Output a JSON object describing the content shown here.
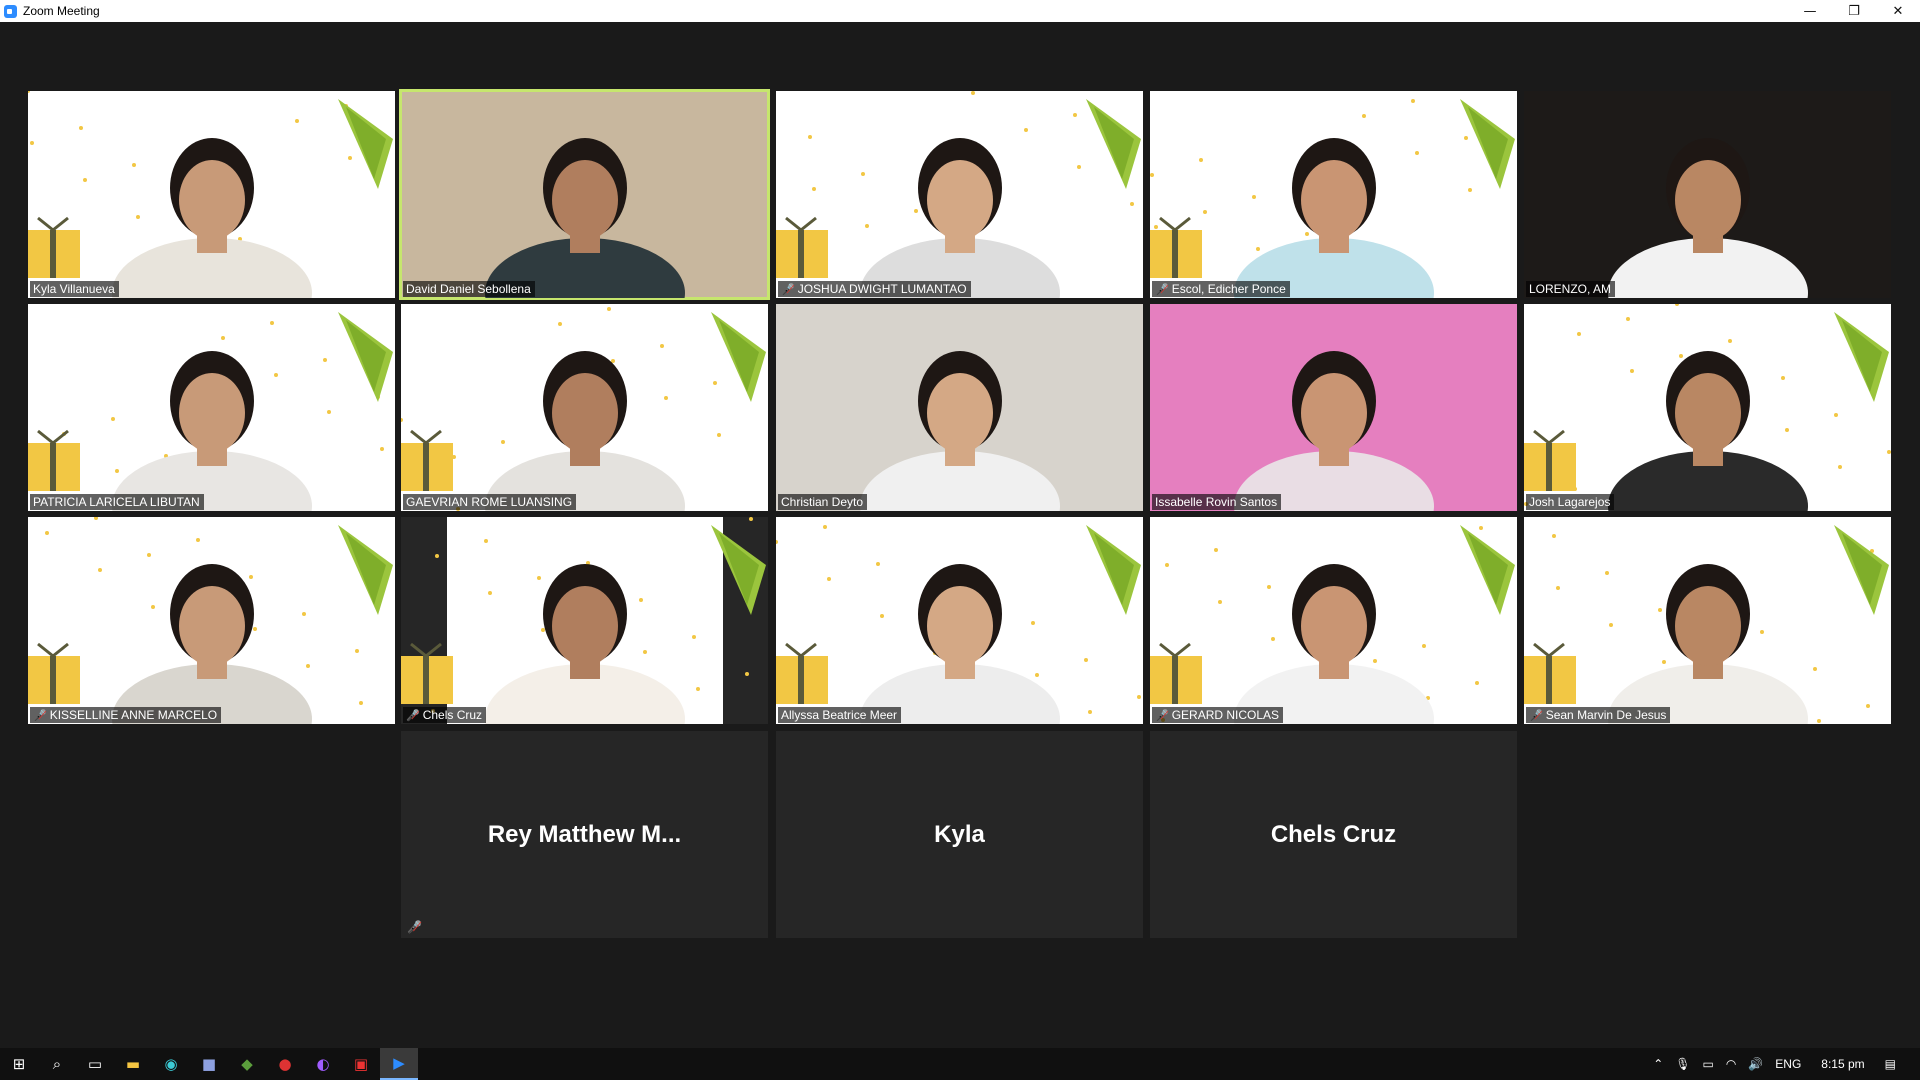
{
  "window": {
    "title": "Zoom Meeting",
    "minimize_glyph": "—",
    "restore_glyph": "❐",
    "close_glyph": "✕"
  },
  "participants": [
    {
      "name": "Kyla Villanueva",
      "muted": false,
      "video": true
    },
    {
      "name": "David Daniel Sebollena",
      "muted": false,
      "video": true,
      "active_speaker": true
    },
    {
      "name": "JOSHUA DWIGHT LUMANTAO",
      "muted": true,
      "video": true
    },
    {
      "name": "Escol, Edicher Ponce",
      "muted": true,
      "video": true
    },
    {
      "name": "LORENZO, AM",
      "muted": false,
      "video": true
    },
    {
      "name": "PATRICIA LARICELA LIBUTAN",
      "muted": false,
      "video": true
    },
    {
      "name": "GAEVRIAN ROME LUANSING",
      "muted": false,
      "video": true
    },
    {
      "name": "Christian Deyto",
      "muted": false,
      "video": true
    },
    {
      "name": "Issabelle Rovin Santos",
      "muted": false,
      "video": true
    },
    {
      "name": "Josh Lagarejos",
      "muted": false,
      "video": true
    },
    {
      "name": "KISSELLINE ANNE MARCELO",
      "muted": true,
      "video": true
    },
    {
      "name": "Chels Cruz",
      "muted": true,
      "video": true
    },
    {
      "name": "Allyssa Beatrice Meer",
      "muted": false,
      "video": true
    },
    {
      "name": "GERARD NICOLAS",
      "muted": true,
      "video": true
    },
    {
      "name": "Sean Marvin De Jesus",
      "muted": true,
      "video": true
    }
  ],
  "video_off": [
    {
      "name": "Rey Matthew M...",
      "muted": true
    },
    {
      "name": "Kyla",
      "muted": false
    },
    {
      "name": "Chels Cruz",
      "muted": false
    }
  ],
  "taskbar": {
    "language": "ENG",
    "time": "8:15 pm"
  },
  "colors": {
    "active_speaker_border": "#c6e66d",
    "muted_icon": "#e0322b",
    "stage_bg": "#1a1a1a",
    "tree_green": "#9bc53d",
    "gift_yellow": "#f2c744"
  }
}
